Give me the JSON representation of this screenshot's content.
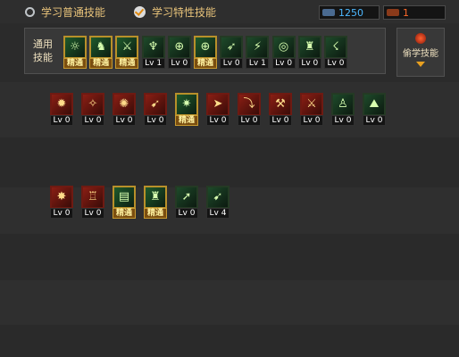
{
  "header": {
    "option_normal": "学习普通技能",
    "option_special": "学习特性技能",
    "sp_value": "1250",
    "tp_value": "1",
    "sp_color": "#4db8ff",
    "tp_color": "#ff6a2a"
  },
  "common_panel": {
    "title": "通用技能",
    "skills": [
      {
        "icon": "sun-circle-icon",
        "glyph": "☼",
        "level": "精通",
        "style": "gold"
      },
      {
        "icon": "crouching-warrior-icon",
        "glyph": "♞",
        "level": "精通",
        "style": "gold"
      },
      {
        "icon": "leaping-warrior-icon",
        "glyph": "⚔",
        "level": "精通",
        "style": "gold"
      },
      {
        "icon": "winged-emblem-icon",
        "glyph": "♆",
        "level": "Lv 1",
        "style": "gr"
      },
      {
        "icon": "crosshair-orb-icon",
        "glyph": "⊕",
        "level": "Lv 0",
        "style": "gr"
      },
      {
        "icon": "crosshair-orb-icon",
        "glyph": "⊕",
        "level": "精通",
        "style": "gold"
      },
      {
        "icon": "charging-figure-icon",
        "glyph": "➶",
        "level": "Lv 0",
        "style": "gr"
      },
      {
        "icon": "kicking-figure-icon",
        "glyph": "⚡",
        "level": "Lv 1",
        "style": "gr"
      },
      {
        "icon": "target-ring-icon",
        "glyph": "◎",
        "level": "Lv 0",
        "style": "gr"
      },
      {
        "icon": "flexing-figure-icon",
        "glyph": "♜",
        "level": "Lv 0",
        "style": "gr"
      },
      {
        "icon": "running-figure-icon",
        "glyph": "☇",
        "level": "Lv 0",
        "style": "gr"
      }
    ]
  },
  "steal_button": {
    "label": "偷学技能"
  },
  "row1_skills": [
    {
      "icon": "explosion-icon",
      "glyph": "✹",
      "level": "Lv 0",
      "style": "red"
    },
    {
      "icon": "kick-strike-icon",
      "glyph": "✧",
      "level": "Lv 0",
      "style": "red"
    },
    {
      "icon": "burst-icon",
      "glyph": "✺",
      "level": "Lv 0",
      "style": "red"
    },
    {
      "icon": "gun-blast-icon",
      "glyph": "➹",
      "level": "Lv 0",
      "style": "red"
    },
    {
      "icon": "green-burst-icon",
      "glyph": "✷",
      "level": "精通",
      "style": "gold"
    },
    {
      "icon": "dash-strike-icon",
      "glyph": "➤",
      "level": "Lv 0",
      "style": "red"
    },
    {
      "icon": "hook-icon",
      "glyph": "⤵",
      "level": "Lv 0",
      "style": "red"
    },
    {
      "icon": "blade-swing-icon",
      "glyph": "⚒",
      "level": "Lv 0",
      "style": "red"
    },
    {
      "icon": "slash-icon",
      "glyph": "⚔",
      "level": "Lv 0",
      "style": "red"
    },
    {
      "icon": "runner-icon",
      "glyph": "♙",
      "level": "Lv 0",
      "style": "gr"
    },
    {
      "icon": "mountain-icon",
      "glyph": "⛰",
      "level": "Lv 0",
      "style": "gr"
    }
  ],
  "row2_skills": [
    {
      "icon": "flare-icon",
      "glyph": "✸",
      "level": "Lv 0",
      "style": "red"
    },
    {
      "icon": "mech-icon",
      "glyph": "♖",
      "level": "Lv 0",
      "style": "red"
    },
    {
      "icon": "cannon-icon",
      "glyph": "▤",
      "level": "精通",
      "style": "gold"
    },
    {
      "icon": "heavy-gun-icon",
      "glyph": "♜",
      "level": "精通",
      "style": "gold"
    },
    {
      "icon": "rocket-icon",
      "glyph": "➚",
      "level": "Lv 0",
      "style": "gr"
    },
    {
      "icon": "missile-icon",
      "glyph": "➹",
      "level": "Lv 4",
      "style": "gr"
    }
  ]
}
